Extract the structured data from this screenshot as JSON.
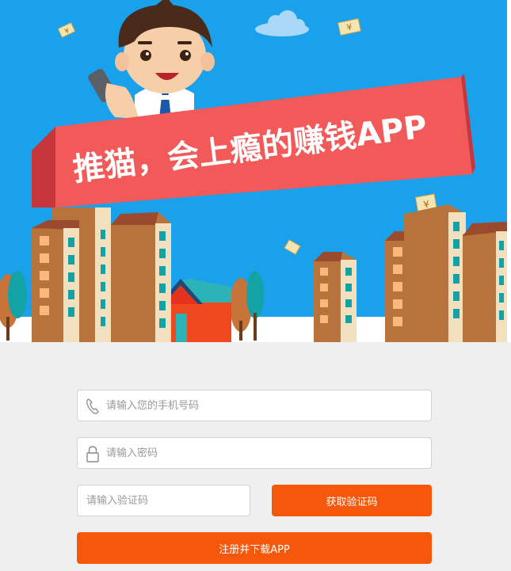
{
  "banner": {
    "slogan": "推猫，会上瘾的赚钱APP",
    "colors": {
      "sky": "#1aa1ec",
      "ribbon": "#f25a5a",
      "ribbon_dark": "#c7363d",
      "building": "#b8733d",
      "building_light": "#f1dfbd",
      "window": "#13a3a6"
    }
  },
  "form": {
    "phone": {
      "placeholder": "请输入您的手机号码",
      "icon": "phone-icon"
    },
    "password": {
      "placeholder": "请输入密码",
      "icon": "lock-icon"
    },
    "code": {
      "placeholder": "请输入验证码"
    },
    "get_code_label": "获取验证码",
    "submit_label": "注册并下载APP",
    "accent": "#f5580a"
  }
}
